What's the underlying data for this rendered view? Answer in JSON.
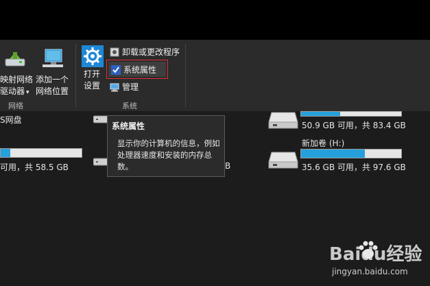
{
  "ribbon": {
    "map_drive": {
      "line1": "映射网络",
      "line2": "驱动器"
    },
    "add_location": {
      "line1": "添加一个",
      "line2": "网络位置"
    },
    "network_group": "网络",
    "open_settings": {
      "line1": "打开",
      "line2": "设置"
    },
    "uninstall": "卸载或更改程序",
    "system_properties": "系统属性",
    "manage": "管理",
    "system_group": "系统"
  },
  "content": {
    "network_drive_label": "S网盘",
    "left_drive": {
      "usage": "可用，共 58.5 GB",
      "fraction_used": 0.12
    },
    "mid_drive": {
      "usage_suffix": "B"
    },
    "right_top_drive": {
      "usage": "50.9 GB 可用，共 83.4 GB",
      "fraction_used": 0.39
    },
    "right_bottom_drive": {
      "name": "新加卷 (H:)",
      "usage": "35.6 GB 可用，共 97.6 GB",
      "fraction_used": 0.64
    }
  },
  "tooltip": {
    "title": "系统属性",
    "body": "显示你的计算机的信息，例如处理器速度和安装的内存总数。"
  },
  "watermark": {
    "logo": "Baidu经验",
    "url": "jingyan.baidu.com"
  },
  "colors": {
    "accent": "#26a0da",
    "highlight": "#e0303a"
  }
}
